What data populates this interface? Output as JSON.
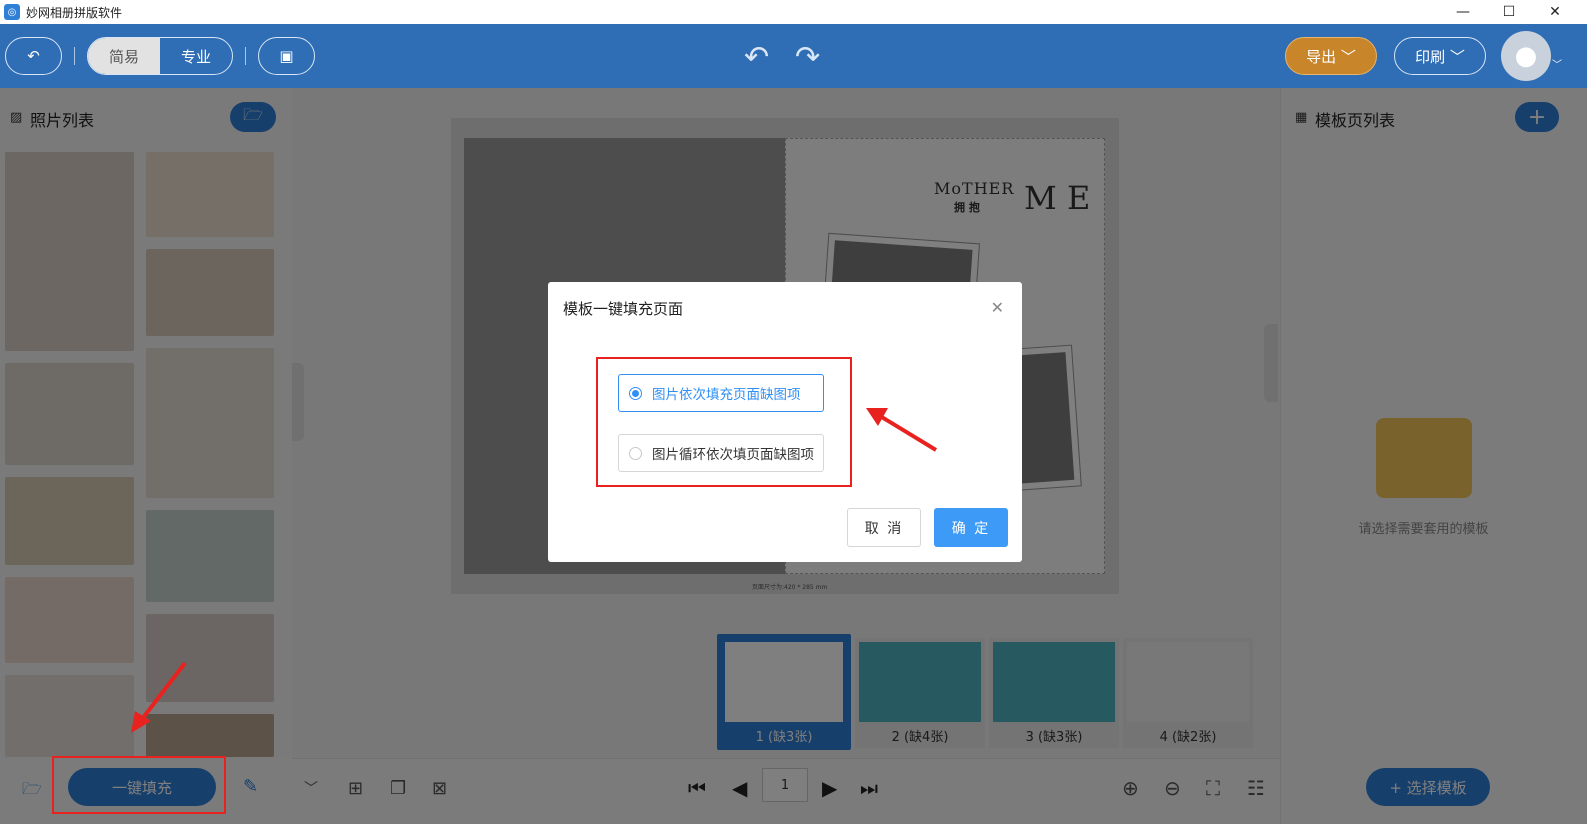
{
  "window": {
    "title": "妙网相册拼版软件",
    "minimize_glyph": "—",
    "maximize_glyph": "☐",
    "close_glyph": "✕"
  },
  "toolbar": {
    "mode_simple": "简易",
    "mode_pro": "专业",
    "export_label": "导出 ﹀",
    "print_label": "印刷 ﹀"
  },
  "left_panel": {
    "title": "照片列表",
    "fill_button": "一键填充"
  },
  "canvas": {
    "mother_text": "MoTHER",
    "hug_text": "拥 抱",
    "me_text": "M E",
    "size_note": "页面尺寸为:420 * 285 mm",
    "pages": [
      {
        "label": "1 (缺3张)",
        "active": true
      },
      {
        "label": "2 (缺4张)",
        "active": false
      },
      {
        "label": "3 (缺3张)",
        "active": false
      },
      {
        "label": "4 (缺2张)",
        "active": false
      }
    ],
    "page_number": "1"
  },
  "right_panel": {
    "title": "模板页列表",
    "empty_hint": "请选择需要套用的模板",
    "choose_button": "+ 选择模板"
  },
  "dialog": {
    "title": "模板一键填充页面",
    "options": [
      {
        "label": "图片依次填充页面缺图项",
        "selected": true
      },
      {
        "label": "图片循环依次填页面缺图项",
        "selected": false
      }
    ],
    "cancel": "取 消",
    "confirm": "确 定"
  },
  "colors": {
    "toolbar": "#2f6db5",
    "accent": "#2f8ff5",
    "export": "#c8852a",
    "annotation": "#e8231f"
  }
}
